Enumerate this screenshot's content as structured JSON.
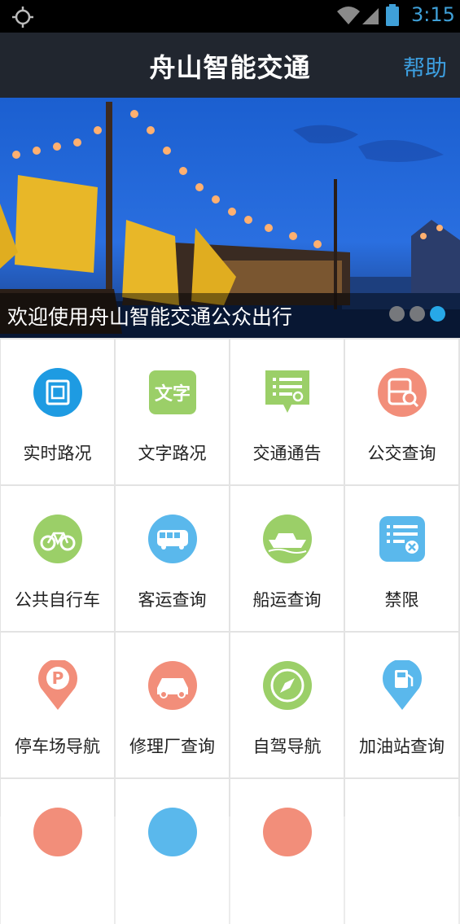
{
  "status_bar": {
    "time": "3:15",
    "time_color": "#3fa0d8"
  },
  "title_bar": {
    "title": "舟山智能交通",
    "help": "帮助",
    "help_color": "#3d9fe0",
    "background": "#21262f"
  },
  "banner": {
    "caption": "欢迎使用舟山智能交通公众出行",
    "page_count": 3,
    "active_page": 3,
    "active_dot_color": "#27a8e8"
  },
  "menu": {
    "items": [
      {
        "label": "实时路况",
        "icon": "map-icon"
      },
      {
        "label": "文字路况",
        "icon": "text-icon"
      },
      {
        "label": "交通通告",
        "icon": "notice-icon"
      },
      {
        "label": "公交查询",
        "icon": "bus-search-icon"
      },
      {
        "label": "公共自行车",
        "icon": "bicycle-icon"
      },
      {
        "label": "客运查询",
        "icon": "coach-icon"
      },
      {
        "label": "船运查询",
        "icon": "ship-icon"
      },
      {
        "label": "禁限",
        "icon": "restriction-icon"
      },
      {
        "label": "停车场导航",
        "icon": "parking-icon"
      },
      {
        "label": "修理厂查询",
        "icon": "repair-icon"
      },
      {
        "label": "自驾导航",
        "icon": "compass-icon"
      },
      {
        "label": "加油站查询",
        "icon": "gas-station-icon"
      }
    ]
  }
}
